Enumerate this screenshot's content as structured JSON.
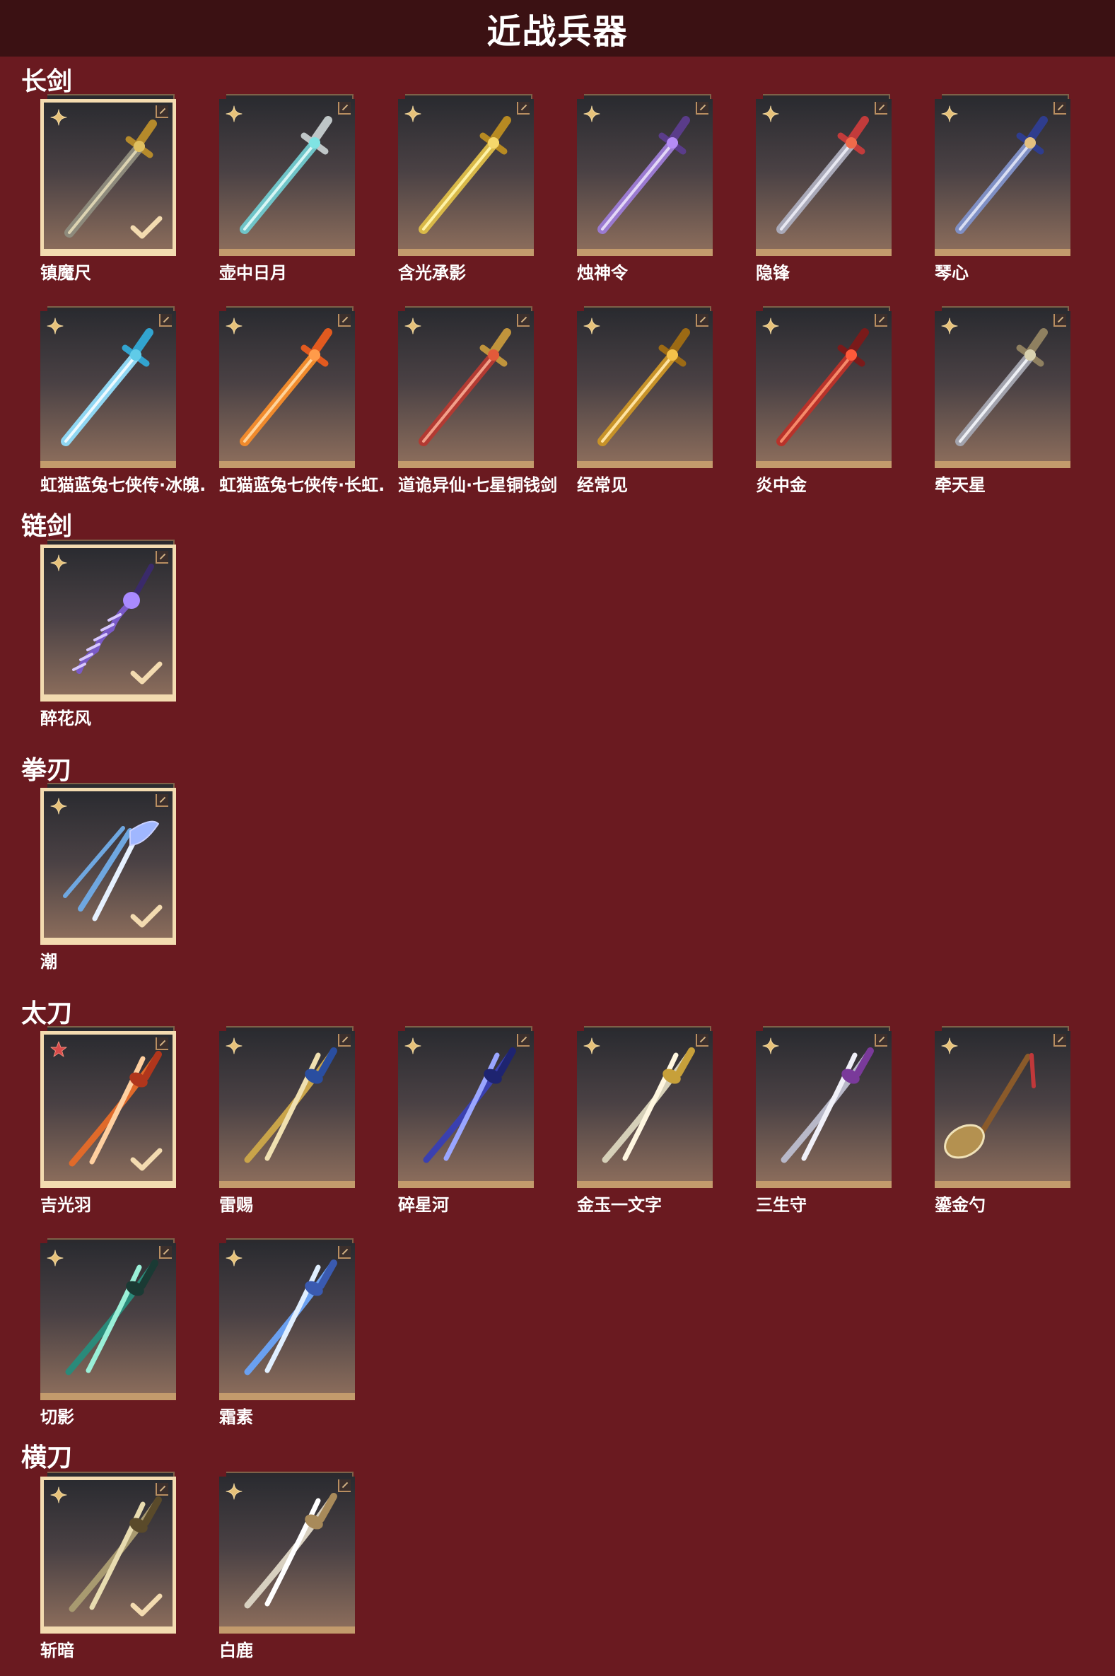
{
  "page": {
    "title": "近战兵器"
  },
  "colors": {
    "background": "#6a1a20",
    "header": "#3b1113",
    "selected_border": "#f3dbb0",
    "tile_trim": "#c39b6c"
  },
  "sections": [
    {
      "title": "长剑",
      "items": [
        {
          "name": "镇魔尺",
          "selected": true,
          "rarity_icon": "four-point-star-icon",
          "weapon_icon": "sword-icon"
        },
        {
          "name": "壶中日月",
          "selected": false,
          "rarity_icon": "four-point-star-icon",
          "weapon_icon": "sword-icon"
        },
        {
          "name": "含光承影",
          "selected": false,
          "rarity_icon": "four-point-star-icon",
          "weapon_icon": "sword-icon"
        },
        {
          "name": "烛神令",
          "selected": false,
          "rarity_icon": "four-point-star-icon",
          "weapon_icon": "sword-icon"
        },
        {
          "name": "隐锋",
          "selected": false,
          "rarity_icon": "four-point-star-icon",
          "weapon_icon": "sword-icon"
        },
        {
          "name": "琴心",
          "selected": false,
          "rarity_icon": "four-point-star-icon",
          "weapon_icon": "sword-icon"
        },
        {
          "name": "虹猫蓝兔七侠传·冰魄.",
          "selected": false,
          "rarity_icon": "four-point-star-icon",
          "weapon_icon": "sword-icon"
        },
        {
          "name": "虹猫蓝兔七侠传·长虹.",
          "selected": false,
          "rarity_icon": "four-point-star-icon",
          "weapon_icon": "sword-icon"
        },
        {
          "name": "道诡异仙·七星铜钱剑",
          "selected": false,
          "rarity_icon": "four-point-star-icon",
          "weapon_icon": "sword-icon"
        },
        {
          "name": "经常见",
          "selected": false,
          "rarity_icon": "four-point-star-icon",
          "weapon_icon": "sword-icon"
        },
        {
          "name": "炎中金",
          "selected": false,
          "rarity_icon": "four-point-star-icon",
          "weapon_icon": "sword-icon"
        },
        {
          "name": "牵天星",
          "selected": false,
          "rarity_icon": "four-point-star-icon",
          "weapon_icon": "sword-icon"
        }
      ]
    },
    {
      "title": "链剑",
      "items": [
        {
          "name": "醉花风",
          "selected": true,
          "rarity_icon": "four-point-star-icon",
          "weapon_icon": "chain-sword-icon"
        }
      ]
    },
    {
      "title": "拳刃",
      "items": [
        {
          "name": "潮",
          "selected": true,
          "rarity_icon": "four-point-star-icon",
          "weapon_icon": "claw-blade-icon"
        }
      ]
    },
    {
      "title": "太刀",
      "items": [
        {
          "name": "吉光羽",
          "selected": true,
          "rarity_icon": "red-star-icon",
          "weapon_icon": "katana-icon"
        },
        {
          "name": "雷赐",
          "selected": false,
          "rarity_icon": "four-point-star-icon",
          "weapon_icon": "katana-icon"
        },
        {
          "name": "碎星河",
          "selected": false,
          "rarity_icon": "four-point-star-icon",
          "weapon_icon": "katana-icon"
        },
        {
          "name": "金玉一文字",
          "selected": false,
          "rarity_icon": "four-point-star-icon",
          "weapon_icon": "katana-icon"
        },
        {
          "name": "三生守",
          "selected": false,
          "rarity_icon": "four-point-star-icon",
          "weapon_icon": "katana-icon"
        },
        {
          "name": "鎏金勺",
          "selected": false,
          "rarity_icon": "four-point-star-icon",
          "weapon_icon": "spoon-icon"
        },
        {
          "name": "切影",
          "selected": false,
          "rarity_icon": "four-point-star-icon",
          "weapon_icon": "katana-icon"
        },
        {
          "name": "霜素",
          "selected": false,
          "rarity_icon": "four-point-star-icon",
          "weapon_icon": "katana-icon"
        }
      ]
    },
    {
      "title": "横刀",
      "items": [
        {
          "name": "斩暗",
          "selected": true,
          "rarity_icon": "four-point-star-icon",
          "weapon_icon": "saber-icon"
        },
        {
          "name": "白鹿",
          "selected": false,
          "rarity_icon": "four-point-star-icon",
          "weapon_icon": "saber-icon"
        }
      ]
    }
  ]
}
